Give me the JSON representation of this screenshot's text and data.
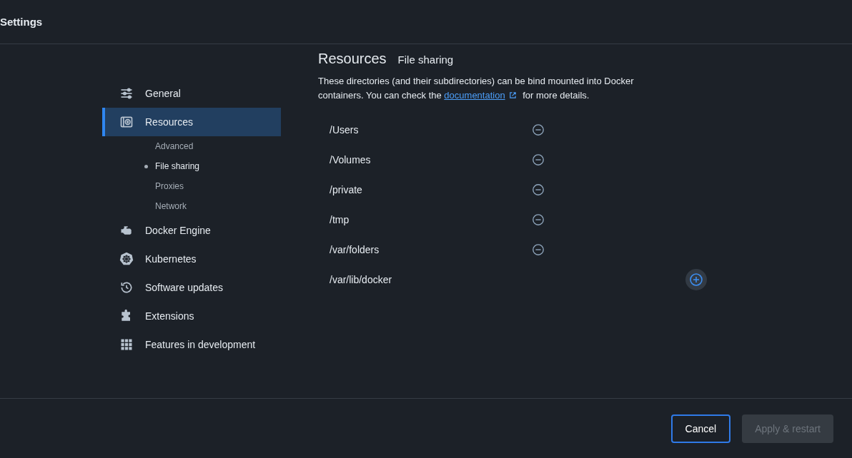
{
  "window": {
    "title": "Settings"
  },
  "sidebar": {
    "items": [
      {
        "label": "General",
        "selected": false
      },
      {
        "label": "Resources",
        "selected": true,
        "children": [
          {
            "label": "Advanced",
            "selected": false
          },
          {
            "label": "File sharing",
            "selected": true
          },
          {
            "label": "Proxies",
            "selected": false
          },
          {
            "label": "Network",
            "selected": false
          }
        ]
      },
      {
        "label": "Docker Engine",
        "selected": false
      },
      {
        "label": "Kubernetes",
        "selected": false
      },
      {
        "label": "Software updates",
        "selected": false
      },
      {
        "label": "Extensions",
        "selected": false
      },
      {
        "label": "Features in development",
        "selected": false
      }
    ]
  },
  "content": {
    "title": "Resources",
    "subtitle": "File sharing",
    "description": {
      "before": "These directories (and their subdirectories) can be bind mounted into Docker containers. You can check the ",
      "link": "documentation",
      "after": " for more details."
    },
    "directories": [
      "/Users",
      "/Volumes",
      "/private",
      "/tmp",
      "/var/folders"
    ],
    "new_directory": {
      "value": "/var/lib/docker"
    }
  },
  "buttons": [
    {
      "label": "Cancel",
      "kind": "secondary",
      "disabled": false
    },
    {
      "label": "Apply & restart",
      "kind": "primary",
      "disabled": true
    }
  ]
}
